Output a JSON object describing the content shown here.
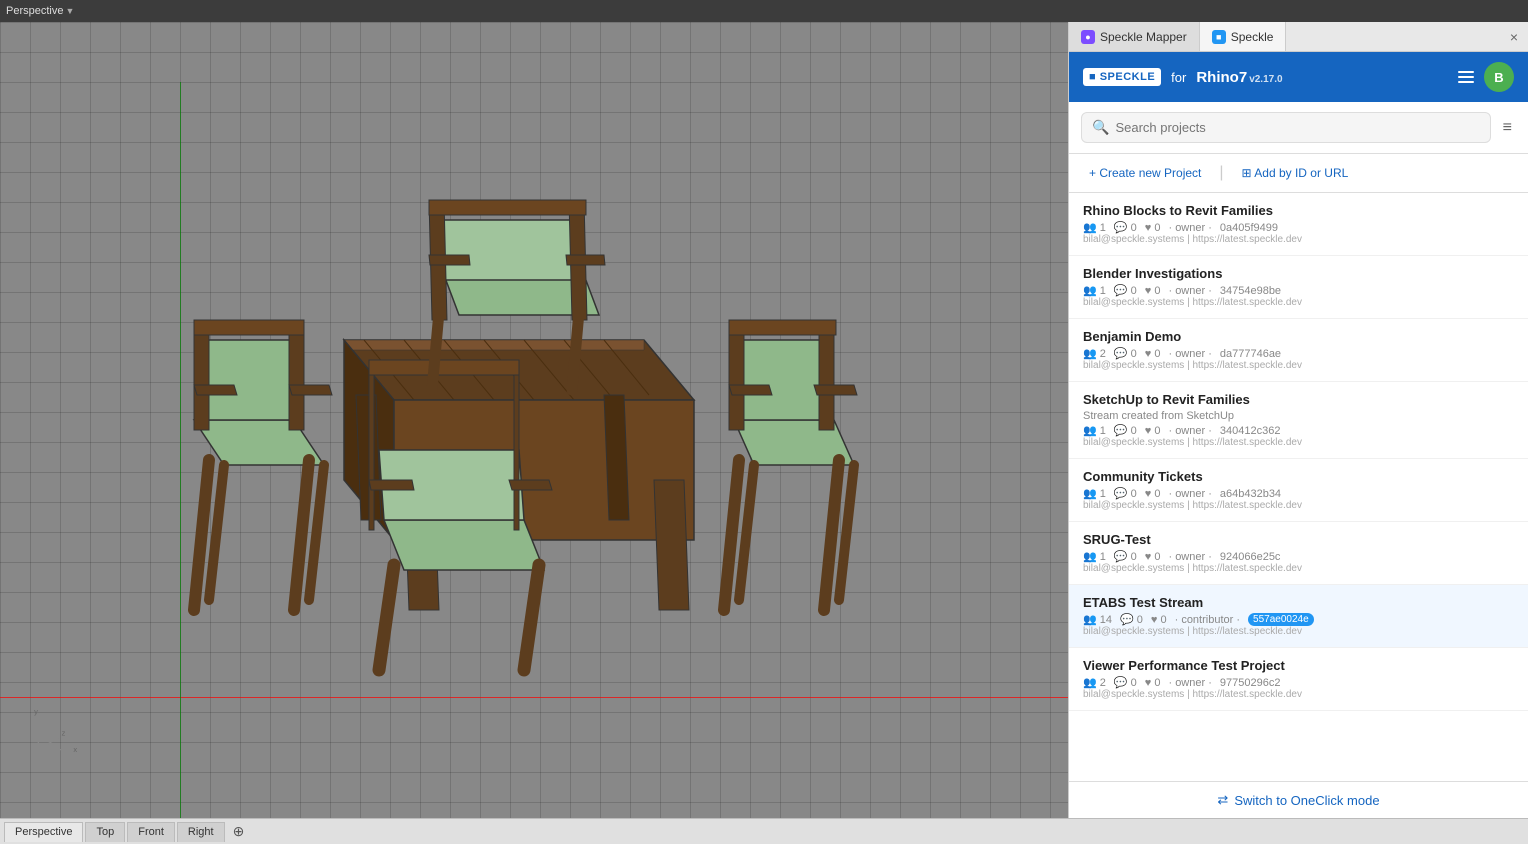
{
  "topbar": {
    "perspective_label": "Perspective",
    "dropdown_arrow": "▼"
  },
  "viewport": {
    "label": "3D Viewport"
  },
  "bottom_tabs": {
    "tabs": [
      {
        "label": "Perspective",
        "active": true
      },
      {
        "label": "Top"
      },
      {
        "label": "Front"
      },
      {
        "label": "Right"
      }
    ],
    "plus": "+"
  },
  "panel": {
    "tabs": [
      {
        "label": "Speckle Mapper",
        "icon": "🟣",
        "active": false
      },
      {
        "label": "Speckle",
        "icon": "🔵",
        "active": true
      }
    ],
    "close_char": "×",
    "header": {
      "logo": "■ SPECKLE",
      "for_text": "for",
      "app_name": "Rhino7",
      "version": "v2.17.0",
      "menu_icon": "menu",
      "avatar_initials": "B"
    },
    "search": {
      "placeholder": "Search projects",
      "filter_icon": "⊟"
    },
    "actions": {
      "create_label": "+ Create new Project",
      "add_label": "⊞ Add by ID or URL"
    },
    "projects": [
      {
        "name": "Rhino Blocks to Revit Families",
        "subtitle": "",
        "members": "1",
        "comments": "0",
        "likes": "0",
        "role": "owner",
        "id": "0a405f9499",
        "email": "bilal@speckle.systems",
        "url": "https://latest.speckle.dev"
      },
      {
        "name": "Blender Investigations",
        "subtitle": "",
        "members": "1",
        "comments": "0",
        "likes": "0",
        "role": "owner",
        "id": "34754e98be",
        "email": "bilal@speckle.systems",
        "url": "https://latest.speckle.dev"
      },
      {
        "name": "Benjamin Demo",
        "subtitle": "",
        "members": "2",
        "comments": "0",
        "likes": "0",
        "role": "owner",
        "id": "da777746ae",
        "email": "bilal@speckle.systems",
        "url": "https://latest.speckle.dev"
      },
      {
        "name": "SketchUp to Revit Families",
        "subtitle": "Stream created from SketchUp",
        "members": "1",
        "comments": "0",
        "likes": "0",
        "role": "owner",
        "id": "340412c362",
        "email": "bilal@speckle.systems",
        "url": "https://latest.speckle.dev"
      },
      {
        "name": "Community Tickets",
        "subtitle": "",
        "members": "1",
        "comments": "0",
        "likes": "0",
        "role": "owner",
        "id": "a64b432b34",
        "email": "bilal@speckle.systems",
        "url": "https://latest.speckle.dev"
      },
      {
        "name": "SRUG-Test",
        "subtitle": "",
        "members": "1",
        "comments": "0",
        "likes": "0",
        "role": "owner",
        "id": "924066e25c",
        "email": "bilal@speckle.systems",
        "url": "https://latest.speckle.dev"
      },
      {
        "name": "ETABS Test Stream",
        "subtitle": "",
        "members": "14",
        "comments": "0",
        "likes": "0",
        "role": "contributor",
        "id": "557ae0024e",
        "email": "bilal@speckle.systems",
        "url": "https://latest.speckle.dev",
        "highlighted": true
      },
      {
        "name": "Viewer Performance Test Project",
        "subtitle": "",
        "members": "2",
        "comments": "0",
        "likes": "0",
        "role": "owner",
        "id": "97750296c2",
        "email": "bilal@speckle.systems",
        "url": "https://latest.speckle.dev"
      }
    ],
    "bottom": {
      "switch_label": "Switch to OneClick mode"
    }
  },
  "colors": {
    "accent_blue": "#1565c0",
    "panel_bg": "#f5f5f5",
    "header_bg": "#1565c0"
  }
}
